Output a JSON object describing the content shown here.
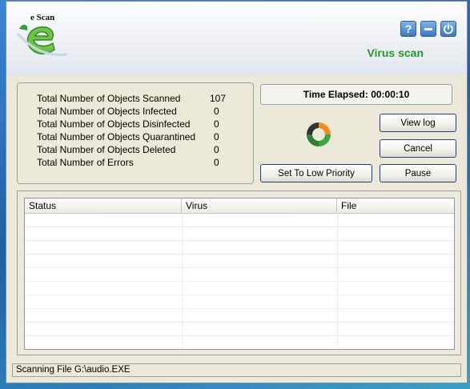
{
  "app": {
    "logo_text": "e Scan",
    "title": "Virus scan",
    "help_label": "?"
  },
  "stats": [
    {
      "label": "Total Number of Objects Scanned",
      "value": "107"
    },
    {
      "label": "Total Number of Objects Infected",
      "value": "0"
    },
    {
      "label": "Total Number of Objects Disinfected",
      "value": "0"
    },
    {
      "label": "Total Number of Objects Quarantined",
      "value": "0"
    },
    {
      "label": "Total Number of Objects Deleted",
      "value": "0"
    },
    {
      "label": "Total Number of Errors",
      "value": "0"
    }
  ],
  "controls": {
    "time_elapsed": "Time Elapsed: 00:00:10",
    "view_log": "View log",
    "cancel": "Cancel",
    "pause": "Pause",
    "priority": "Set To Low Priority"
  },
  "table": {
    "columns": [
      "Status",
      "Virus",
      "File"
    ],
    "rows": []
  },
  "status_bar": "Scanning File G:\\audio.EXE",
  "colors": {
    "title_green": "#1e9c2a",
    "button_border": "#1c3f85",
    "header_button_blue": "#3b78c2"
  },
  "icons": [
    "escan-logo-icon",
    "help-icon",
    "minimize-icon",
    "power-icon",
    "scan-spinner-icon"
  ]
}
